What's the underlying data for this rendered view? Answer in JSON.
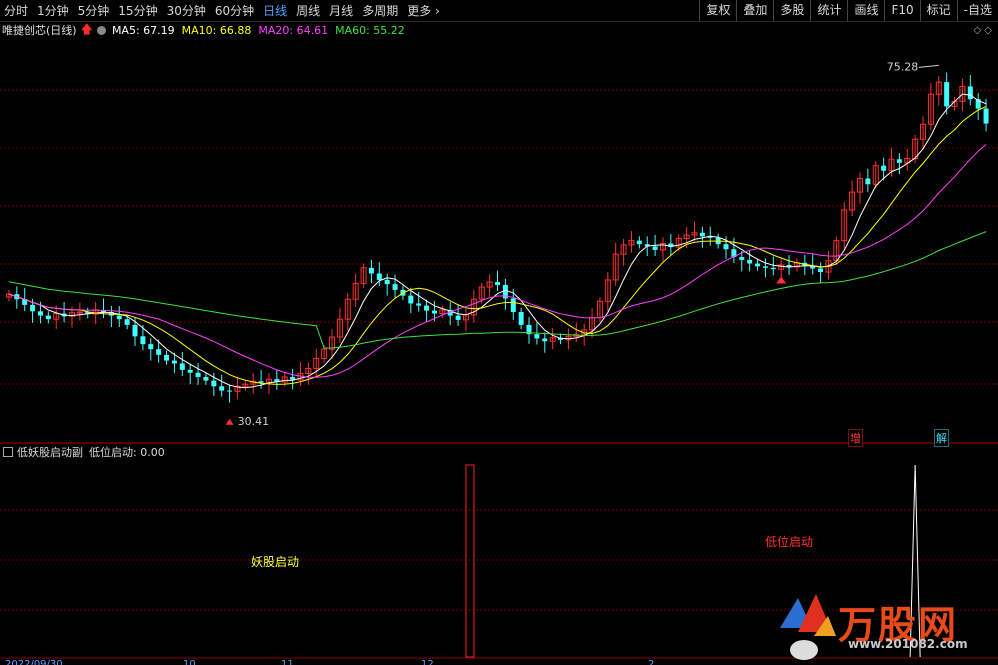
{
  "toolbar": {
    "periods": [
      "分时",
      "1分钟",
      "5分钟",
      "15分钟",
      "30分钟",
      "60分钟",
      "日线",
      "周线",
      "月线",
      "多周期",
      "更多"
    ],
    "active_period": "日线",
    "right_buttons": [
      "复权",
      "叠加",
      "多股",
      "统计",
      "画线",
      "F10",
      "标记",
      "-自选"
    ]
  },
  "info": {
    "stock": "唯捷创芯(日线)",
    "ma5": "MA5: 67.19",
    "ma10": "MA10: 66.88",
    "ma20": "MA20: 64.61",
    "ma60": "MA60: 55.22"
  },
  "colors": {
    "ma5": "#ffffff",
    "ma10": "#ffff00",
    "ma20": "#ff40ff",
    "ma60": "#40e040",
    "up": "#ff3030",
    "down": "#40ffff",
    "grid": "#7a0000"
  },
  "price_labels": {
    "high": "75.28",
    "low": "30.41"
  },
  "markers": {
    "zeng": "增",
    "jie": "解"
  },
  "indicator": {
    "name": "低妖股启动副",
    "value": "低位启动: 0.00",
    "label1": "妖股启动",
    "label2": "低位启动"
  },
  "axis_dates": [
    "2022/09/30",
    "10",
    "11",
    "12",
    "2"
  ],
  "chart_data": {
    "type": "candlestick",
    "title": "唯捷创芯(日线)",
    "ylim": [
      28,
      78
    ],
    "high": 75.28,
    "low": 30.41,
    "series": [
      {
        "name": "MA5",
        "last": 67.19
      },
      {
        "name": "MA10",
        "last": 66.88
      },
      {
        "name": "MA20",
        "last": 64.61
      },
      {
        "name": "MA60",
        "last": 55.22
      }
    ],
    "closes": [
      44.5,
      43.8,
      43.0,
      42.1,
      41.5,
      41.0,
      41.8,
      41.4,
      41.9,
      42.0,
      41.7,
      42.3,
      42.0,
      41.5,
      41.0,
      40.2,
      38.6,
      37.5,
      36.8,
      36.0,
      35.2,
      34.8,
      33.9,
      33.5,
      32.9,
      32.4,
      31.6,
      31.0,
      30.9,
      31.6,
      31.9,
      32.3,
      32.1,
      32.6,
      32.2,
      32.9,
      32.5,
      33.4,
      34.1,
      35.5,
      36.8,
      38.5,
      41.0,
      43.8,
      46.0,
      48.2,
      47.4,
      46.5,
      45.9,
      45.1,
      44.3,
      43.2,
      42.9,
      42.2,
      41.8,
      42.3,
      41.5,
      40.9,
      41.6,
      43.8,
      45.5,
      46.2,
      45.8,
      43.9,
      42.0,
      40.2,
      38.9,
      38.3,
      37.9,
      38.4,
      38.1,
      38.6,
      38.9,
      39.5,
      41.2,
      43.5,
      46.5,
      50.1,
      51.4,
      52.0,
      51.5,
      51.2,
      50.7,
      51.6,
      51.1,
      52.3,
      52.8,
      53.1,
      52.6,
      52.4,
      51.5,
      50.8,
      49.7,
      49.3,
      48.8,
      48.4,
      48.2,
      48.0,
      48.6,
      48.3,
      48.9,
      48.5,
      48.1,
      47.6,
      49.2,
      52.0,
      56.3,
      58.8,
      60.7,
      59.9,
      62.5,
      61.8,
      63.4,
      62.9,
      63.5,
      66.2,
      68.3,
      72.5,
      74.2,
      70.8,
      71.5,
      73.6,
      71.8,
      70.5,
      68.4
    ]
  },
  "indicator_data": {
    "type": "bar",
    "spike1_index": 58,
    "spike2_index": 115
  }
}
